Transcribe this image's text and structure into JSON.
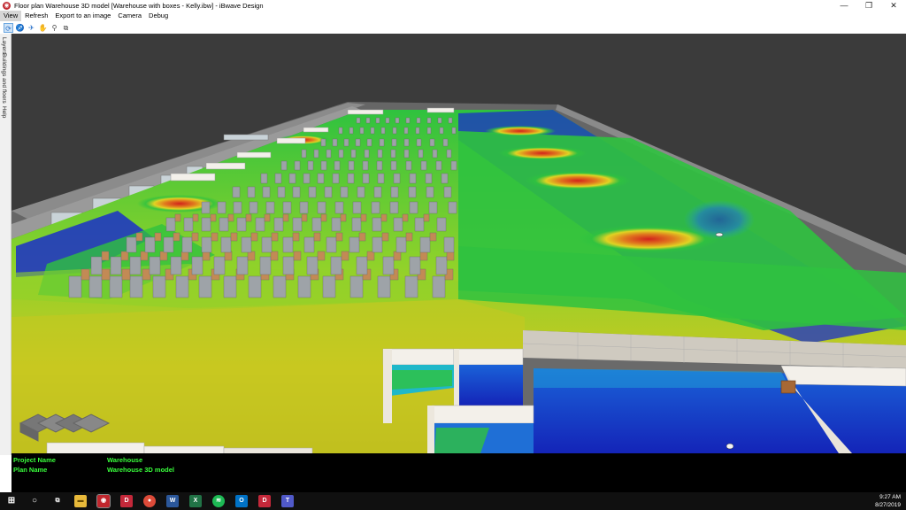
{
  "window": {
    "title": "Floor plan Warehouse 3D model [Warehouse with boxes - Kelly.ibw] - iBwave Design",
    "app_icon": "ibwave-app-icon",
    "controls": [
      "minimize",
      "restore",
      "close"
    ]
  },
  "menu": {
    "items": [
      "View",
      "Refresh",
      "Export to an image",
      "Camera",
      "Debug"
    ],
    "active": "View"
  },
  "toolbar": {
    "tools": [
      "orbit-tool-icon",
      "walk-tool-icon",
      "fly-tool-icon",
      "pan-hand-icon",
      "zoom-icon",
      "zoom-window-icon"
    ]
  },
  "side_tabs": [
    "Layers",
    "Buildings and floors",
    "Help"
  ],
  "info": {
    "project_label": "Project Name",
    "project_value": "Warehouse",
    "plan_label": "Plan Name",
    "plan_value": "Warehouse 3D model"
  },
  "taskbar": {
    "time": "9:27 AM",
    "date": "8/27/2019",
    "apps": [
      "windows-start-icon",
      "search-circle-icon",
      "task-view-icon",
      "file-explorer-icon",
      "ibwave-taskbar-icon",
      "red-app-icon",
      "chrome-icon",
      "word-icon",
      "excel-icon",
      "spotify-icon",
      "outlook-icon",
      "red-app-icon-2",
      "teams-icon"
    ]
  },
  "colors": {
    "info_text": "#39ff3c",
    "heatmap_strong": "#d2221c",
    "heatmap_good": "#2fc23f",
    "heatmap_mid": "#c8c821",
    "heatmap_weak": "#1a2fc9"
  }
}
